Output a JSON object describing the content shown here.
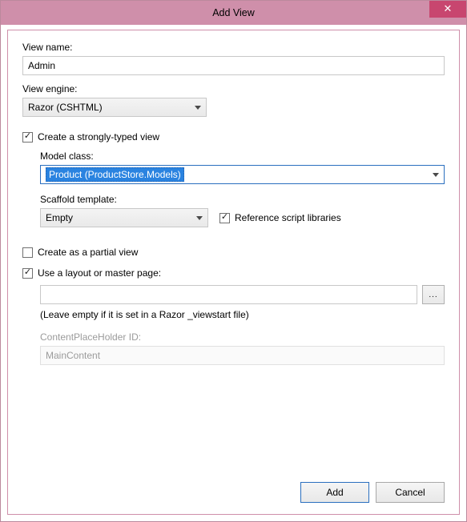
{
  "window": {
    "title": "Add View",
    "close_glyph": "✕"
  },
  "view_name": {
    "label": "View name:",
    "value": "Admin"
  },
  "view_engine": {
    "label": "View engine:",
    "value": "Razor (CSHTML)"
  },
  "strongly_typed": {
    "label": "Create a strongly-typed view",
    "checked": true
  },
  "model_class": {
    "label": "Model class:",
    "value": "Product (ProductStore.Models)"
  },
  "scaffold": {
    "label": "Scaffold template:",
    "value": "Empty"
  },
  "reference_scripts": {
    "label": "Reference script libraries",
    "checked": true
  },
  "partial_view": {
    "label": "Create as a partial view",
    "checked": false
  },
  "use_layout": {
    "label": "Use a layout or master page:",
    "checked": true
  },
  "layout_path": {
    "value": ""
  },
  "layout_hint": "(Leave empty if it is set in a Razor _viewstart file)",
  "placeholder": {
    "label": "ContentPlaceHolder ID:",
    "value": "MainContent"
  },
  "browse_label": "...",
  "buttons": {
    "add": "Add",
    "cancel": "Cancel"
  }
}
